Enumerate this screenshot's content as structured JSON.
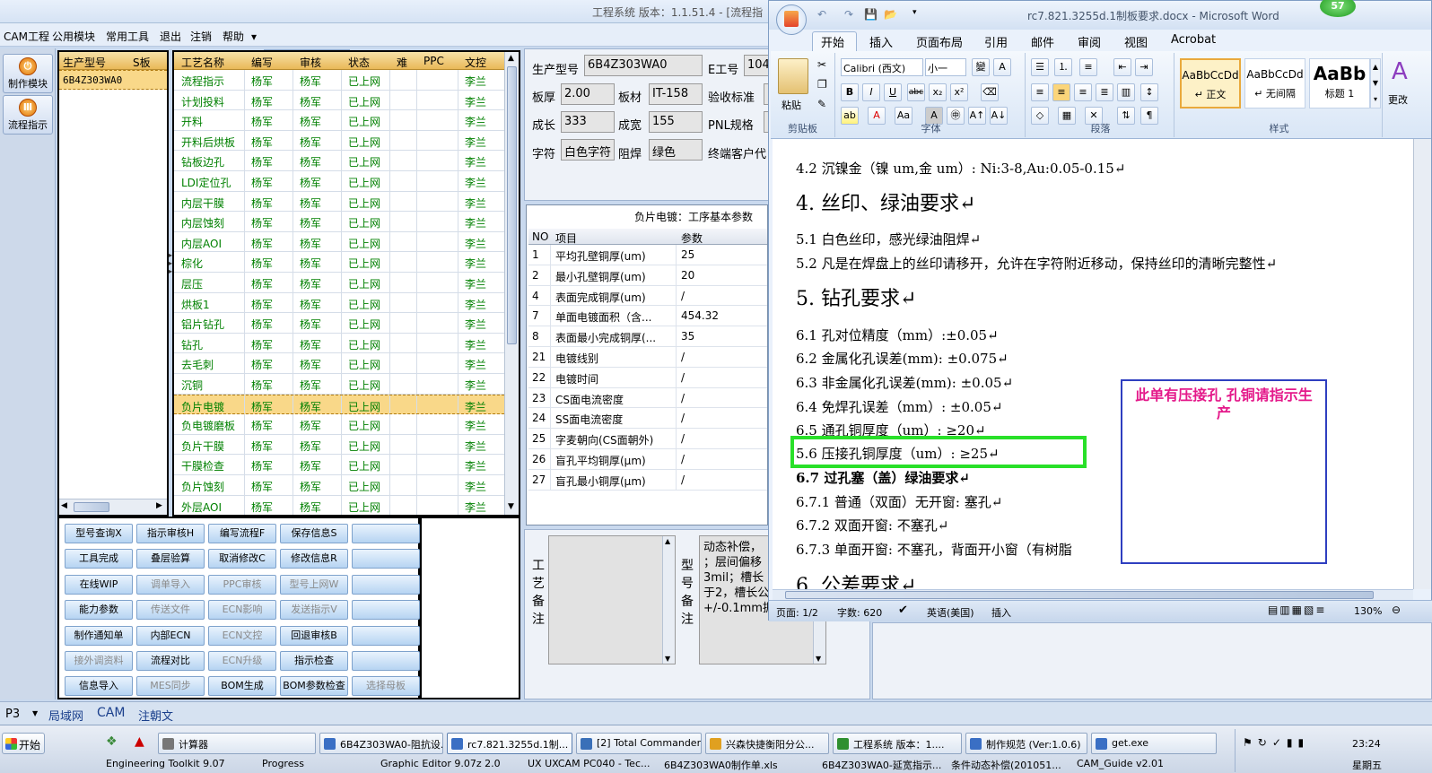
{
  "app": {
    "title": "工程系统  版本：1.1.51.4 - [流程指",
    "menu": [
      "CAM工程",
      "公用模块",
      "常用工具",
      "退出",
      "注销",
      "帮助"
    ],
    "menu_arrow": "▾",
    "combo_value": ""
  },
  "sidebar": {
    "items": [
      {
        "label": "制作模块"
      },
      {
        "label": "流程指示"
      }
    ]
  },
  "models": {
    "headers": [
      "生产型号",
      "S板"
    ],
    "rows": [
      "6B4Z303WA0"
    ]
  },
  "flow": {
    "headers": [
      "工艺名称",
      "编写",
      "审核",
      "状态",
      "难",
      "PPC",
      "文控"
    ],
    "rows": [
      [
        "流程指示",
        "杨军",
        "杨军",
        "已上网",
        "李兰"
      ],
      [
        "计划投料",
        "杨军",
        "杨军",
        "已上网",
        "李兰"
      ],
      [
        "开料",
        "杨军",
        "杨军",
        "已上网",
        "李兰"
      ],
      [
        "开料后烘板",
        "杨军",
        "杨军",
        "已上网",
        "李兰"
      ],
      [
        "钻板边孔",
        "杨军",
        "杨军",
        "已上网",
        "李兰"
      ],
      [
        "LDI定位孔",
        "杨军",
        "杨军",
        "已上网",
        "李兰"
      ],
      [
        "内层干膜",
        "杨军",
        "杨军",
        "已上网",
        "李兰"
      ],
      [
        "内层蚀刻",
        "杨军",
        "杨军",
        "已上网",
        "李兰"
      ],
      [
        "内层AOI",
        "杨军",
        "杨军",
        "已上网",
        "李兰"
      ],
      [
        "棕化",
        "杨军",
        "杨军",
        "已上网",
        "李兰"
      ],
      [
        "层压",
        "杨军",
        "杨军",
        "已上网",
        "李兰"
      ],
      [
        "烘板1",
        "杨军",
        "杨军",
        "已上网",
        "李兰"
      ],
      [
        "铝片钻孔",
        "杨军",
        "杨军",
        "已上网",
        "李兰"
      ],
      [
        "钻孔",
        "杨军",
        "杨军",
        "已上网",
        "李兰"
      ],
      [
        "去毛刺",
        "杨军",
        "杨军",
        "已上网",
        "李兰"
      ],
      [
        "沉铜",
        "杨军",
        "杨军",
        "已上网",
        "李兰"
      ],
      [
        "负片电镀",
        "杨军",
        "杨军",
        "已上网",
        "李兰"
      ],
      [
        "负电镀磨板",
        "杨军",
        "杨军",
        "已上网",
        "李兰"
      ],
      [
        "负片干膜",
        "杨军",
        "杨军",
        "已上网",
        "李兰"
      ],
      [
        "干膜检查",
        "杨军",
        "杨军",
        "已上网",
        "李兰"
      ],
      [
        "负片蚀刻",
        "杨军",
        "杨军",
        "已上网",
        "李兰"
      ],
      [
        "外层AOI",
        "杨军",
        "杨军",
        "已上网",
        "李兰"
      ]
    ],
    "selected_index": 16
  },
  "buttons": [
    [
      "型号查询X",
      "指示审核H",
      "编写流程F",
      "保存信息S",
      ""
    ],
    [
      "工具完成",
      "叠层验算",
      "取消修改C",
      "修改信息R",
      ""
    ],
    [
      "在线WIP",
      "调单导入",
      "PPC审核",
      "型号上网W",
      ""
    ],
    [
      "能力参数",
      "传送文件",
      "ECN影响",
      "发送指示V",
      ""
    ],
    [
      "制作通知单",
      "内部ECN",
      "ECN文控",
      "回退审核B",
      ""
    ],
    [
      "接外调资料",
      "流程对比",
      "ECN升级",
      "指示检查",
      ""
    ],
    [
      "信息导入",
      "MES同步",
      "BOM生成",
      "BOM参数检查",
      "选择母板"
    ]
  ],
  "buttons_disabled": [
    "调单导入",
    "PPC审核",
    "型号上网W",
    "传送文件",
    "ECN影响",
    "发送指示V",
    "ECN文控",
    "接外调资料",
    "ECN升级",
    "MES同步",
    "选择母板"
  ],
  "info": {
    "model_label": "生产型号",
    "model_value": "6B4Z303WA0",
    "e_label": "E工号",
    "e_value": "104",
    "thick_label": "板厚",
    "thick_value": "2.00",
    "mat_label": "板材",
    "mat_value": "IT-158",
    "accept_label": "验收标准",
    "len_label": "成长",
    "len_value": "333",
    "wid_label": "成宽",
    "wid_value": "155",
    "pnl_label": "PNL规格",
    "char_label": "字符",
    "char_value": "白色字符",
    "mask_label": "阻焊",
    "mask_value": "绿色",
    "cust_label": "终端客户代"
  },
  "params": {
    "title": "负片电镀：工序基本参数",
    "headers": [
      "NO",
      "项目",
      "参数"
    ],
    "rows": [
      [
        "1",
        "平均孔壁铜厚(um)",
        "25"
      ],
      [
        "2",
        "最小孔壁铜厚(um)",
        "20"
      ],
      [
        "4",
        "表面完成铜厚(um)",
        "/"
      ],
      [
        "7",
        "单面电镀面积（含...",
        "454.32"
      ],
      [
        "8",
        "表面最小完成铜厚(...",
        "35"
      ],
      [
        "21",
        "电镀线别",
        "/"
      ],
      [
        "22",
        "电镀时间",
        "/"
      ],
      [
        "23",
        "CS面电流密度",
        "/"
      ],
      [
        "24",
        "SS面电流密度",
        "/"
      ],
      [
        "25",
        "字麦朝向(CS面朝外)",
        "/"
      ],
      [
        "26",
        "盲孔平均铜厚(μm)",
        "/"
      ],
      [
        "27",
        "盲孔最小铜厚(μm)",
        "/"
      ]
    ]
  },
  "remarks": {
    "craft_label": "工艺备注",
    "model_label": "型号备注",
    "model_text": [
      "动态补偿，",
      "；层间偏移",
      "3mil；槽长",
      "于2，槽长公",
      "+/-0.1mm据"
    ]
  },
  "word": {
    "title": "rc7.821.3255d.1制板要求.docx - Microsoft Word",
    "badge": "57",
    "qat": [
      "↶",
      "↷",
      "💾",
      "📂"
    ],
    "tabs": [
      "开始",
      "插入",
      "页面布局",
      "引用",
      "邮件",
      "审阅",
      "视图",
      "Acrobat"
    ],
    "paste_label": "粘贴",
    "font_name": "Calibri (西文)",
    "font_size": "小一",
    "groups": [
      "剪贴板",
      "字体",
      "段落",
      "样式"
    ],
    "styles": [
      {
        "sample": "AaBbCcDd",
        "name": "↵ 正文"
      },
      {
        "sample": "AaBbCcDd",
        "name": "↵ 无间隔"
      },
      {
        "sample": "AaBb",
        "name": "标题 1"
      }
    ],
    "change_style": "更改",
    "doc": {
      "l1": "4.2 沉镍金（镍 um,金 um）:    Ni:3-8,Au:0.05-0.15↵",
      "h4": "4. 丝印、绿油要求↵",
      "l2": "5.1 白色丝印，感光绿油阻焊↵",
      "l3": "5.2 凡是在焊盘上的丝印请移开，允许在字符附近移动，保持丝印的清晰完整性↵",
      "h5": "5. 钻孔要求↵",
      "l4": "6.1 孔对位精度（mm）:±0.05↵",
      "l5": "6.2 金属化孔误差(mm): ±0.075↵",
      "l6": "6.3 非金属化孔误差(mm): ±0.05↵",
      "l7": "6.4 免焊孔误差（mm）: ±0.05↵",
      "l8": "6.5 通孔铜厚度（um）: ≥20↵",
      "l9": "5.6 压接孔铜厚度（um）: ≥25↵",
      "l10": "6.7 过孔塞（盖）绿油要求↵",
      "l11": "6.7.1 普通（双面）无开窗: 塞孔↵",
      "l12": "6.7.2 双面开窗: 不塞孔↵",
      "l13": "6.7.3 单面开窗: 不塞孔，背面开小窗（有树脂",
      "h6": "6. 公差要求↵",
      "note": "此单有压接孔  孔铜请指示生产"
    },
    "status": {
      "page": "页面: 1/2",
      "words": "字数: 620",
      "lang": "英语(美国)",
      "mode": "插入",
      "zoom": "130%"
    }
  },
  "bottom_tabs": [
    "P3",
    "局域网",
    "CAM",
    "注朝文"
  ],
  "taskbar": {
    "start": "开始",
    "tasks": [
      "计算器",
      "6B4Z303WA0-阻抗设...",
      "rc7.821.3255d.1制...",
      "[2] Total Commander ...",
      "兴森快捷衡阳分公...",
      "工程系统  版本：1....",
      "制作规范 (Ver:1.0.6)",
      "get.exe"
    ],
    "tasks2": [
      "Engineering Toolkit 9.07",
      "Progress",
      "Graphic Editor 9.07z 2.0",
      "UX UXCAM PC040 - Tec...",
      "6B4Z303WA0制作单.xls",
      "6B4Z303WA0-延宽指示...",
      "条件动态补偿(201051...",
      "CAM_Guide v2.01"
    ],
    "clock": "23:24",
    "day": "星期五"
  }
}
